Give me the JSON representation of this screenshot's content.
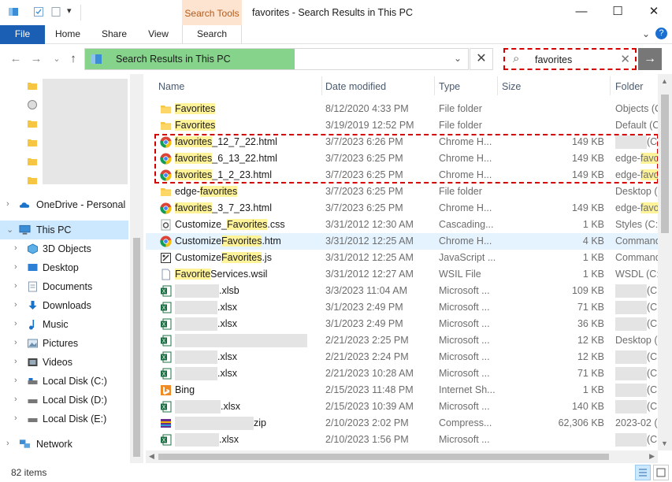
{
  "window": {
    "title": "favorites - Search Results in This PC",
    "context_tab": "Search Tools",
    "minimize": "—",
    "maximize": "☐",
    "close": "✕"
  },
  "ribbon": {
    "tabs": [
      "File",
      "Home",
      "Share",
      "View",
      "Search"
    ],
    "help": "?",
    "expand": "⌄"
  },
  "address": {
    "path": "Search Results in This PC",
    "back": "←",
    "forward": "→",
    "recent": "⌄",
    "up": "↑",
    "dropdown": "⌄",
    "refresh": "✕"
  },
  "search": {
    "value": "favorites",
    "go": "→"
  },
  "nav": {
    "items": [
      {
        "label": "OneDrive - Personal"
      },
      {
        "label": "This PC"
      },
      {
        "label": "3D Objects"
      },
      {
        "label": "Desktop"
      },
      {
        "label": "Documents"
      },
      {
        "label": "Downloads"
      },
      {
        "label": "Music"
      },
      {
        "label": "Pictures"
      },
      {
        "label": "Videos"
      },
      {
        "label": "Local Disk (C:)"
      },
      {
        "label": "Local Disk (D:)"
      },
      {
        "label": "Local Disk (E:)"
      },
      {
        "label": "Network"
      }
    ]
  },
  "columns": {
    "name": "Name",
    "date": "Date modified",
    "type": "Type",
    "size": "Size",
    "folder": "Folder"
  },
  "files": [
    {
      "pre": "",
      "hl": "Favorites",
      "post": "",
      "date": "8/12/2020 4:33 PM",
      "type": "File folder",
      "size": "",
      "folder": "Objects (C:",
      "icon": "folder"
    },
    {
      "pre": "",
      "hl": "Favorites",
      "post": "",
      "date": "3/19/2019 12:52 PM",
      "type": "File folder",
      "size": "",
      "folder": "Default (C:",
      "icon": "folder"
    },
    {
      "pre": "",
      "hl": "favorites",
      "post": "_12_7_22.html",
      "date": "3/7/2023 6:26 PM",
      "type": "Chrome H...",
      "size": "149 KB",
      "folder": "(C:\\",
      "icon": "chrome"
    },
    {
      "pre": "",
      "hl": "favorites",
      "post": "_6_13_22.html",
      "date": "3/7/2023 6:25 PM",
      "type": "Chrome H...",
      "size": "149 KB",
      "folder": "edge-favo",
      "icon": "chrome"
    },
    {
      "pre": "",
      "hl": "favorites",
      "post": "_1_2_23.html",
      "date": "3/7/2023 6:25 PM",
      "type": "Chrome H...",
      "size": "149 KB",
      "folder": "edge-favo",
      "icon": "chrome"
    },
    {
      "pre": "edge-",
      "hl": "favorites",
      "post": "",
      "date": "3/7/2023 6:25 PM",
      "type": "File folder",
      "size": "",
      "folder": "Desktop (C",
      "icon": "folder"
    },
    {
      "pre": "",
      "hl": "favorites",
      "post": "_3_7_23.html",
      "date": "3/7/2023 6:25 PM",
      "type": "Chrome H...",
      "size": "149 KB",
      "folder": "edge-favo",
      "icon": "chrome"
    },
    {
      "pre": "Customize_",
      "hl": "Favorites",
      "post": ".css",
      "date": "3/31/2012 12:30 AM",
      "type": "Cascading...",
      "size": "1 KB",
      "folder": "Styles (C:\\",
      "icon": "gear"
    },
    {
      "pre": "Customize",
      "hl": "Favorites",
      "post": ".htm",
      "date": "3/31/2012 12:25 AM",
      "type": "Chrome H...",
      "size": "4 KB",
      "folder": "Command",
      "icon": "chrome"
    },
    {
      "pre": "Customize",
      "hl": "Favorites",
      "post": ".js",
      "date": "3/31/2012 12:25 AM",
      "type": "JavaScript ...",
      "size": "1 KB",
      "folder": "Command",
      "icon": "script"
    },
    {
      "pre": "",
      "hl": "Favorite",
      "post": "Services.wsil",
      "date": "3/31/2012 12:27 AM",
      "type": "WSIL File",
      "size": "1 KB",
      "folder": "WSDL (C:\\",
      "icon": "doc"
    },
    {
      "pre": "",
      "hl": "",
      "post": ".xlsb",
      "date": "3/3/2023 11:04 AM",
      "type": "Microsoft ...",
      "size": "109 KB",
      "folder": "(C",
      "icon": "excel"
    },
    {
      "pre": "",
      "hl": "",
      "post": ".xlsx",
      "date": "3/1/2023 2:49 PM",
      "type": "Microsoft ...",
      "size": "71 KB",
      "folder": "(C",
      "icon": "excel"
    },
    {
      "pre": "",
      "hl": "",
      "post": ".xlsx",
      "date": "3/1/2023 2:49 PM",
      "type": "Microsoft ...",
      "size": "36 KB",
      "folder": "(C",
      "icon": "excel"
    },
    {
      "pre": "",
      "hl": "",
      "post": "",
      "date": "2/21/2023 2:25 PM",
      "type": "Microsoft ...",
      "size": "12 KB",
      "folder": "Desktop (C",
      "icon": "excel"
    },
    {
      "pre": "",
      "hl": "",
      "post": ".xlsx",
      "date": "2/21/2023 2:24 PM",
      "type": "Microsoft ...",
      "size": "12 KB",
      "folder": "(C",
      "icon": "excel"
    },
    {
      "pre": "",
      "hl": "",
      "post": ".xlsx",
      "date": "2/21/2023 10:28 AM",
      "type": "Microsoft ...",
      "size": "71 KB",
      "folder": "(C",
      "icon": "excel"
    },
    {
      "pre": "Bing",
      "hl": "",
      "post": "",
      "date": "2/15/2023 11:48 PM",
      "type": "Internet Sh...",
      "size": "1 KB",
      "folder": "(C",
      "icon": "bing"
    },
    {
      "pre": "",
      "hl": "",
      "post": ".xlsx",
      "date": "2/15/2023 10:39 AM",
      "type": "Microsoft ...",
      "size": "140 KB",
      "folder": "(C",
      "icon": "excel"
    },
    {
      "pre": "",
      "hl": "",
      "post": "zip",
      "date": "2/10/2023 2:02 PM",
      "type": "Compress...",
      "size": "62,306 KB",
      "folder": "2023-02 (C",
      "icon": "zip"
    },
    {
      "pre": "",
      "hl": "",
      "post": ".xlsx",
      "date": "2/10/2023 1:56 PM",
      "type": "Microsoft ...",
      "size": "",
      "folder": "(C",
      "icon": "excel"
    }
  ],
  "status": {
    "count": "82 items"
  }
}
